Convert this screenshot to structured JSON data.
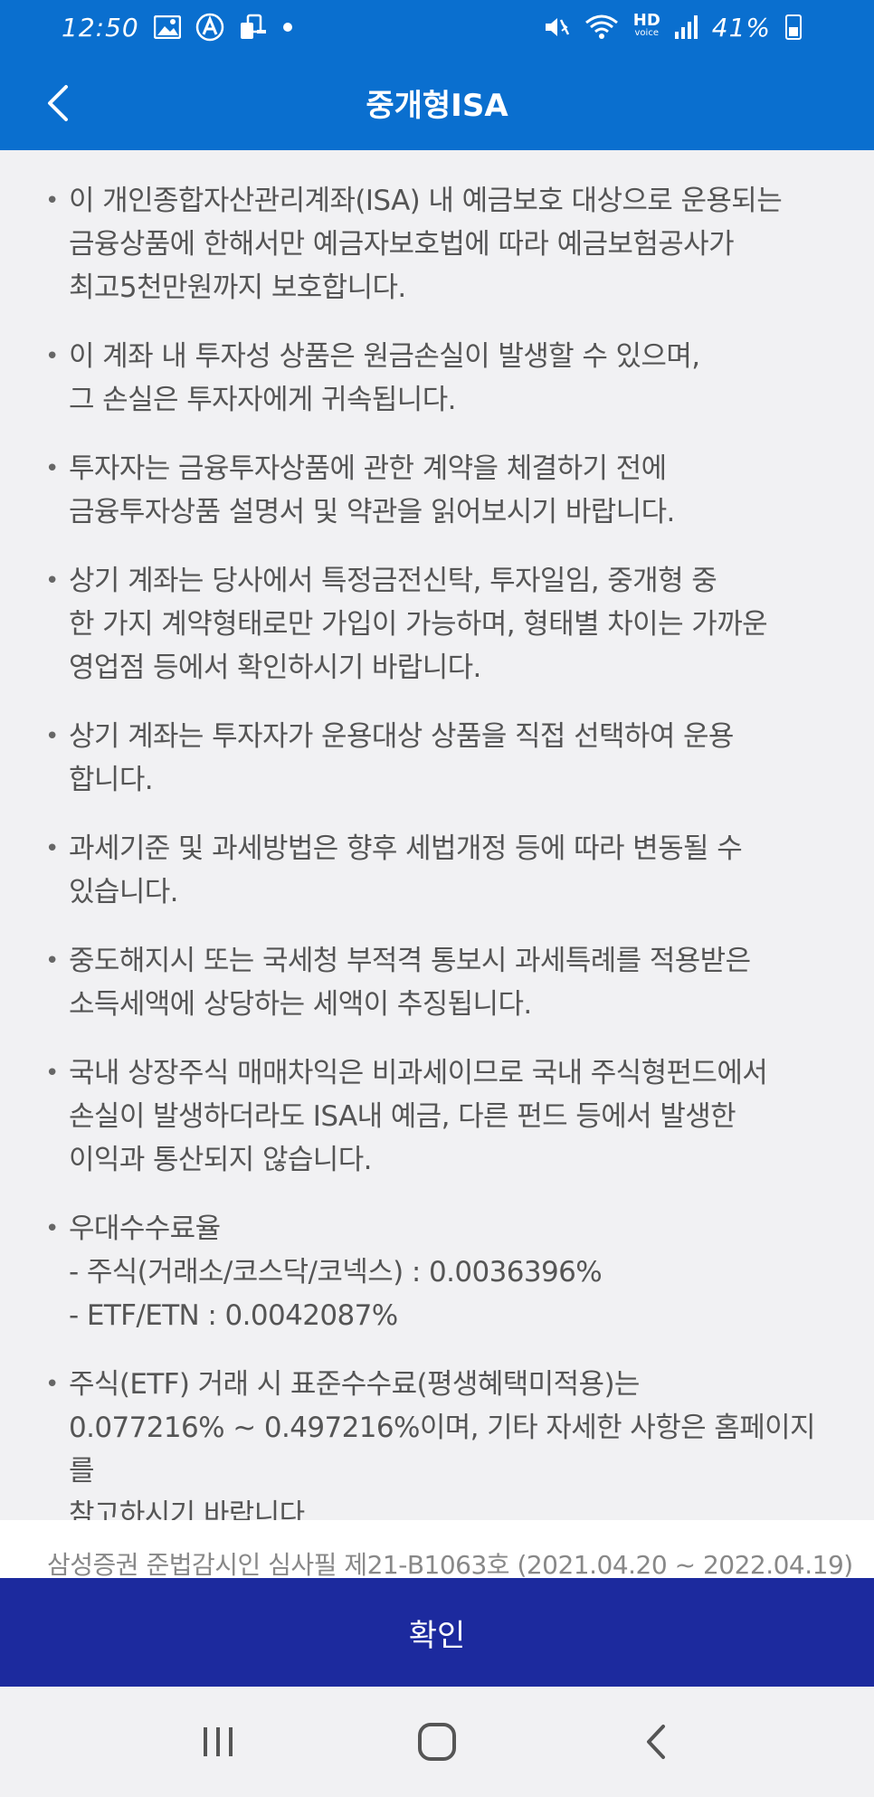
{
  "status": {
    "time": "12:50",
    "battery": "41%",
    "hd_top": "HD",
    "hd_bottom": "voice",
    "left_icons": [
      "image-icon",
      "a-circle-icon",
      "share-icon",
      "dot-icon"
    ],
    "right_icons": [
      "mute-icon",
      "wifi-icon",
      "hd-voice-icon",
      "signal-icon",
      "battery-icon"
    ]
  },
  "header": {
    "title": "중개형ISA",
    "back_icon": "chevron-left-icon"
  },
  "notices": [
    "이 개인종합자산관리계좌(ISA) 내 예금보호 대상으로 운용되는\n금융상품에 한해서만 예금자보호법에 따라 예금보험공사가\n최고5천만원까지 보호합니다.",
    "이 계좌 내 투자성 상품은 원금손실이 발생할 수 있으며,\n그 손실은 투자자에게 귀속됩니다.",
    "투자자는 금융투자상품에 관한 계약을 체결하기 전에\n금융투자상품 설명서 및 약관을 읽어보시기 바랍니다.",
    "상기 계좌는 당사에서 특정금전신탁, 투자일임, 중개형 중\n한 가지 계약형태로만 가입이 가능하며, 형태별 차이는 가까운\n영업점 등에서 확인하시기 바랍니다.",
    "상기 계좌는 투자자가 운용대상 상품을 직접 선택하여 운용\n합니다.",
    "과세기준 및 과세방법은 향후 세법개정 등에 따라 변동될 수\n있습니다.",
    "중도해지시 또는 국세청 부적격 통보시 과세특례를 적용받은\n소득세액에 상당하는 세액이 추징됩니다.",
    "국내 상장주식 매매차익은 비과세이므로 국내 주식형펀드에서\n손실이 발생하더라도 ISA내 예금, 다른 펀드 등에서 발생한\n이익과 통산되지 않습니다.",
    "우대수수료율\n- 주식(거래소/코스닥/코넥스) : 0.0036396%\n- ETF/ETN : 0.0042087%",
    "주식(ETF) 거래 시 표준수수료(평생혜택미적용)는\n0.077216% ~ 0.497216%이며, 기타 자세한 사항은 홈페이지를\n참고하시기 바랍니다."
  ],
  "footer": {
    "compliance": "삼성증권 준법감시인 심사필 제21-B1063호 (2021.04.20 ~ 2022.04.19)"
  },
  "confirm_label": "확인",
  "nav": {
    "recent_icon": "recent-apps-icon",
    "home_icon": "home-icon",
    "back_icon": "back-icon"
  },
  "colors": {
    "header_bg": "#0a6fcf",
    "confirm_bg": "#1c2a9e",
    "content_bg": "#f1f1f3",
    "text": "#555555"
  }
}
